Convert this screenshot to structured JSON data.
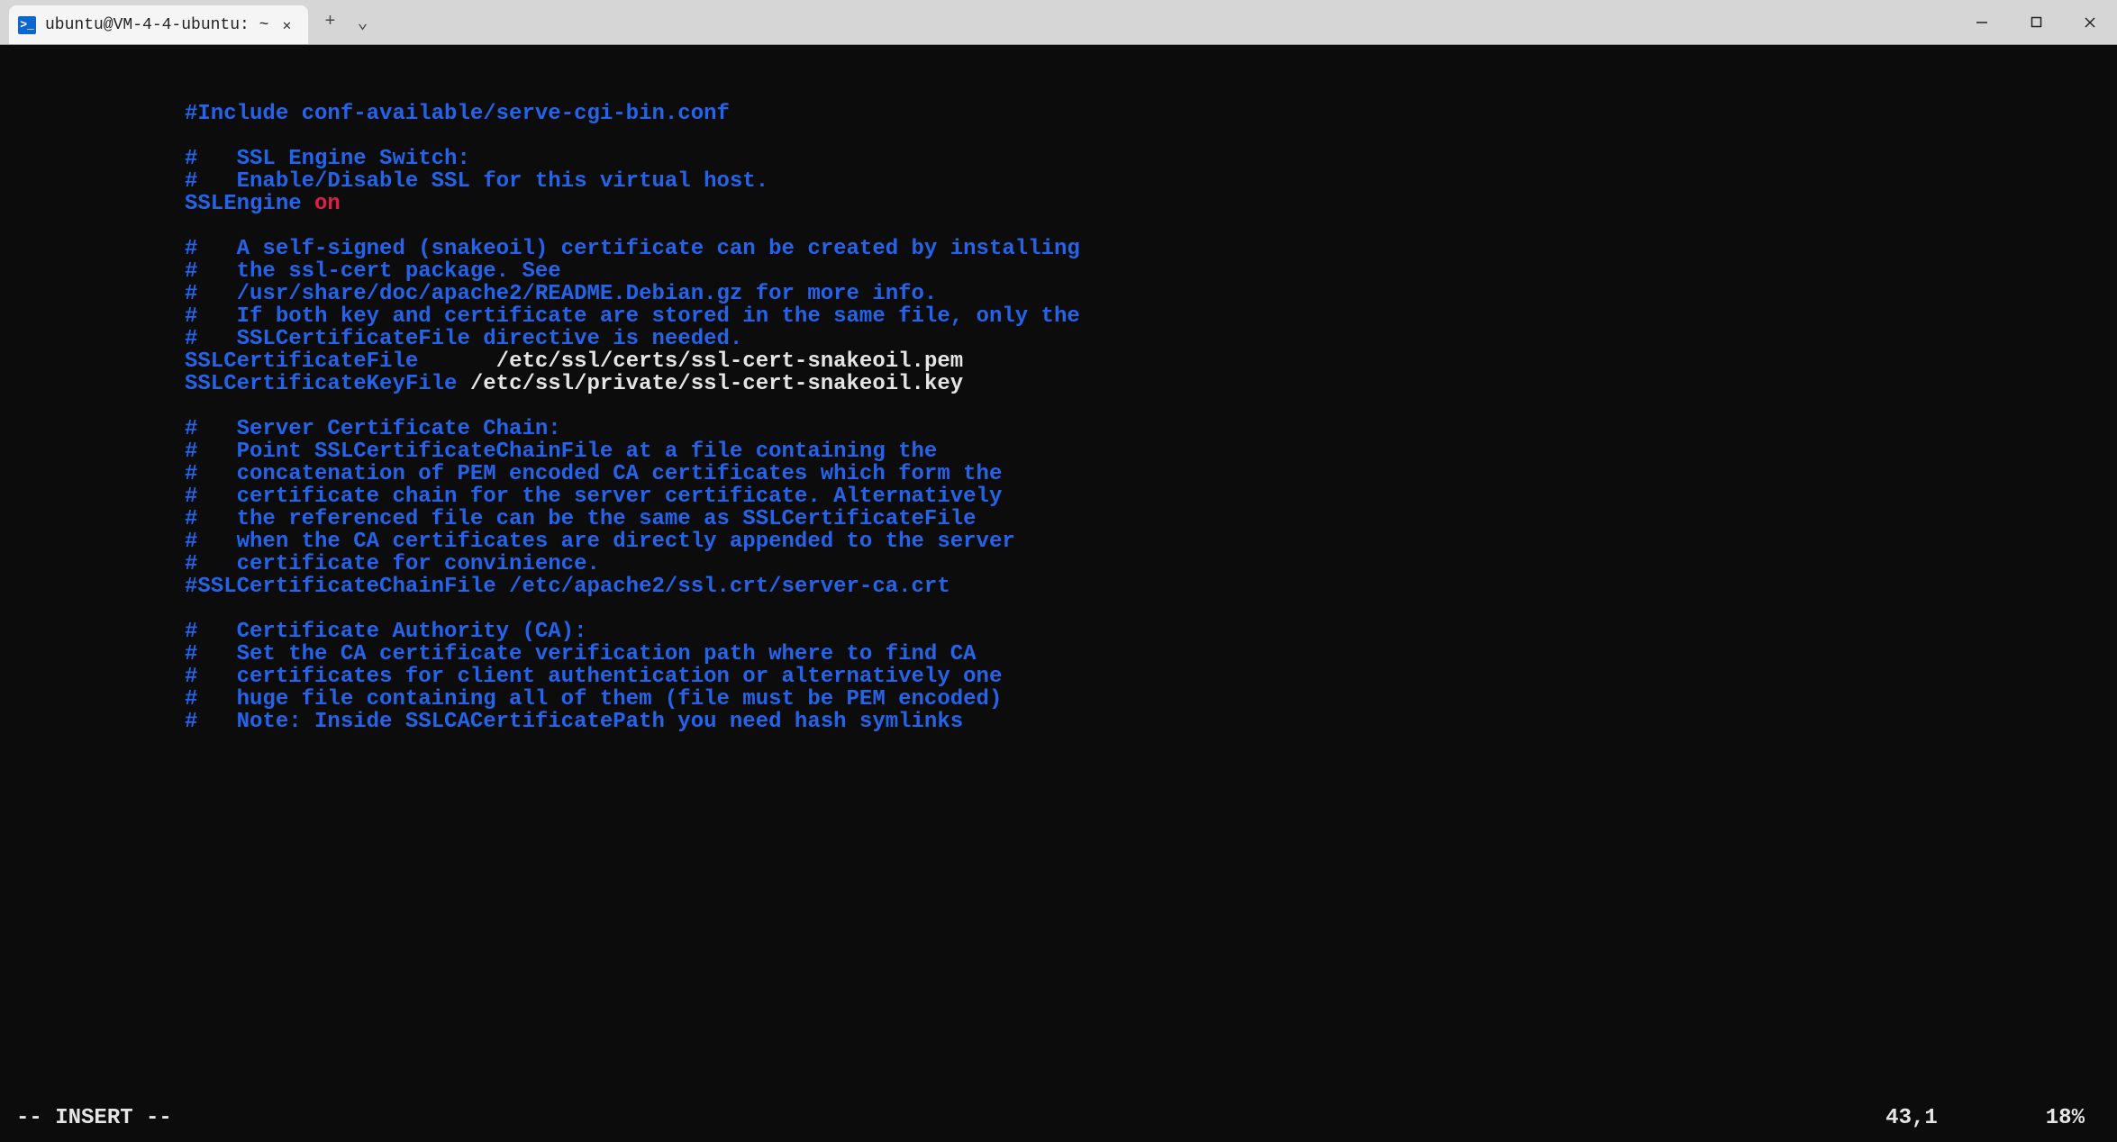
{
  "titlebar": {
    "tab_icon_label": ">_",
    "tab_title": "ubuntu@VM-4-4-ubuntu: ~",
    "close_glyph": "✕",
    "new_tab_glyph": "+",
    "dropdown_glyph": "⌄",
    "minimize": "—",
    "maximize": "▢",
    "closewin": "✕"
  },
  "editor": {
    "indent": "",
    "lines": [
      {
        "segs": [
          {
            "cls": "blue",
            "t": "#Include conf-available/serve-cgi-bin.conf"
          }
        ]
      },
      {
        "segs": []
      },
      {
        "segs": [
          {
            "cls": "blue",
            "t": "#   SSL Engine Switch:"
          }
        ]
      },
      {
        "segs": [
          {
            "cls": "blue",
            "t": "#   Enable/Disable SSL for this virtual host."
          }
        ]
      },
      {
        "segs": [
          {
            "cls": "blue",
            "t": "SSLEngine "
          },
          {
            "cls": "red",
            "t": "on"
          }
        ]
      },
      {
        "segs": []
      },
      {
        "segs": [
          {
            "cls": "blue",
            "t": "#   A self-signed (snakeoil) certificate can be created by installing"
          }
        ]
      },
      {
        "segs": [
          {
            "cls": "blue",
            "t": "#   the ssl-cert package. See"
          }
        ]
      },
      {
        "segs": [
          {
            "cls": "blue",
            "t": "#   /usr/share/doc/apache2/README.Debian.gz for more info."
          }
        ]
      },
      {
        "segs": [
          {
            "cls": "blue",
            "t": "#   If both key and certificate are stored in the same file, only the"
          }
        ]
      },
      {
        "segs": [
          {
            "cls": "blue",
            "t": "#   SSLCertificateFile directive is needed."
          }
        ]
      },
      {
        "segs": [
          {
            "cls": "blue",
            "t": "SSLCertificateFile"
          },
          {
            "cls": "white",
            "t": "      /etc/ssl/certs/ssl-cert-snakeoil.pem"
          }
        ]
      },
      {
        "segs": [
          {
            "cls": "blue",
            "t": "SSLCertificateKeyFile"
          },
          {
            "cls": "white",
            "t": " /etc/ssl/private/ssl-cert-snakeoil.key"
          }
        ]
      },
      {
        "segs": []
      },
      {
        "segs": [
          {
            "cls": "blue",
            "t": "#   Server Certificate Chain:"
          }
        ]
      },
      {
        "segs": [
          {
            "cls": "blue",
            "t": "#   Point SSLCertificateChainFile at a file containing the"
          }
        ]
      },
      {
        "segs": [
          {
            "cls": "blue",
            "t": "#   concatenation of PEM encoded CA certificates which form the"
          }
        ]
      },
      {
        "segs": [
          {
            "cls": "blue",
            "t": "#   certificate chain for the server certificate. Alternatively"
          }
        ]
      },
      {
        "segs": [
          {
            "cls": "blue",
            "t": "#   the referenced file can be the same as SSLCertificateFile"
          }
        ]
      },
      {
        "segs": [
          {
            "cls": "blue",
            "t": "#   when the CA certificates are directly appended to the server"
          }
        ]
      },
      {
        "segs": [
          {
            "cls": "blue",
            "t": "#   certificate for convinience."
          }
        ]
      },
      {
        "segs": [
          {
            "cls": "blue",
            "t": "#SSLCertificateChainFile /etc/apache2/ssl.crt/server-ca.crt"
          }
        ]
      },
      {
        "segs": []
      },
      {
        "segs": [
          {
            "cls": "blue",
            "t": "#   Certificate Authority (CA):"
          }
        ]
      },
      {
        "segs": [
          {
            "cls": "blue",
            "t": "#   Set the CA certificate verification path where to find CA"
          }
        ]
      },
      {
        "segs": [
          {
            "cls": "blue",
            "t": "#   certificates for client authentication or alternatively one"
          }
        ]
      },
      {
        "segs": [
          {
            "cls": "blue",
            "t": "#   huge file containing all of them (file must be PEM encoded)"
          }
        ]
      },
      {
        "segs": [
          {
            "cls": "blue",
            "t": "#   Note: Inside SSLCACertificatePath you need hash symlinks"
          }
        ]
      }
    ]
  },
  "status": {
    "mode": "-- INSERT --",
    "position": "43,1",
    "percent": "18%"
  }
}
